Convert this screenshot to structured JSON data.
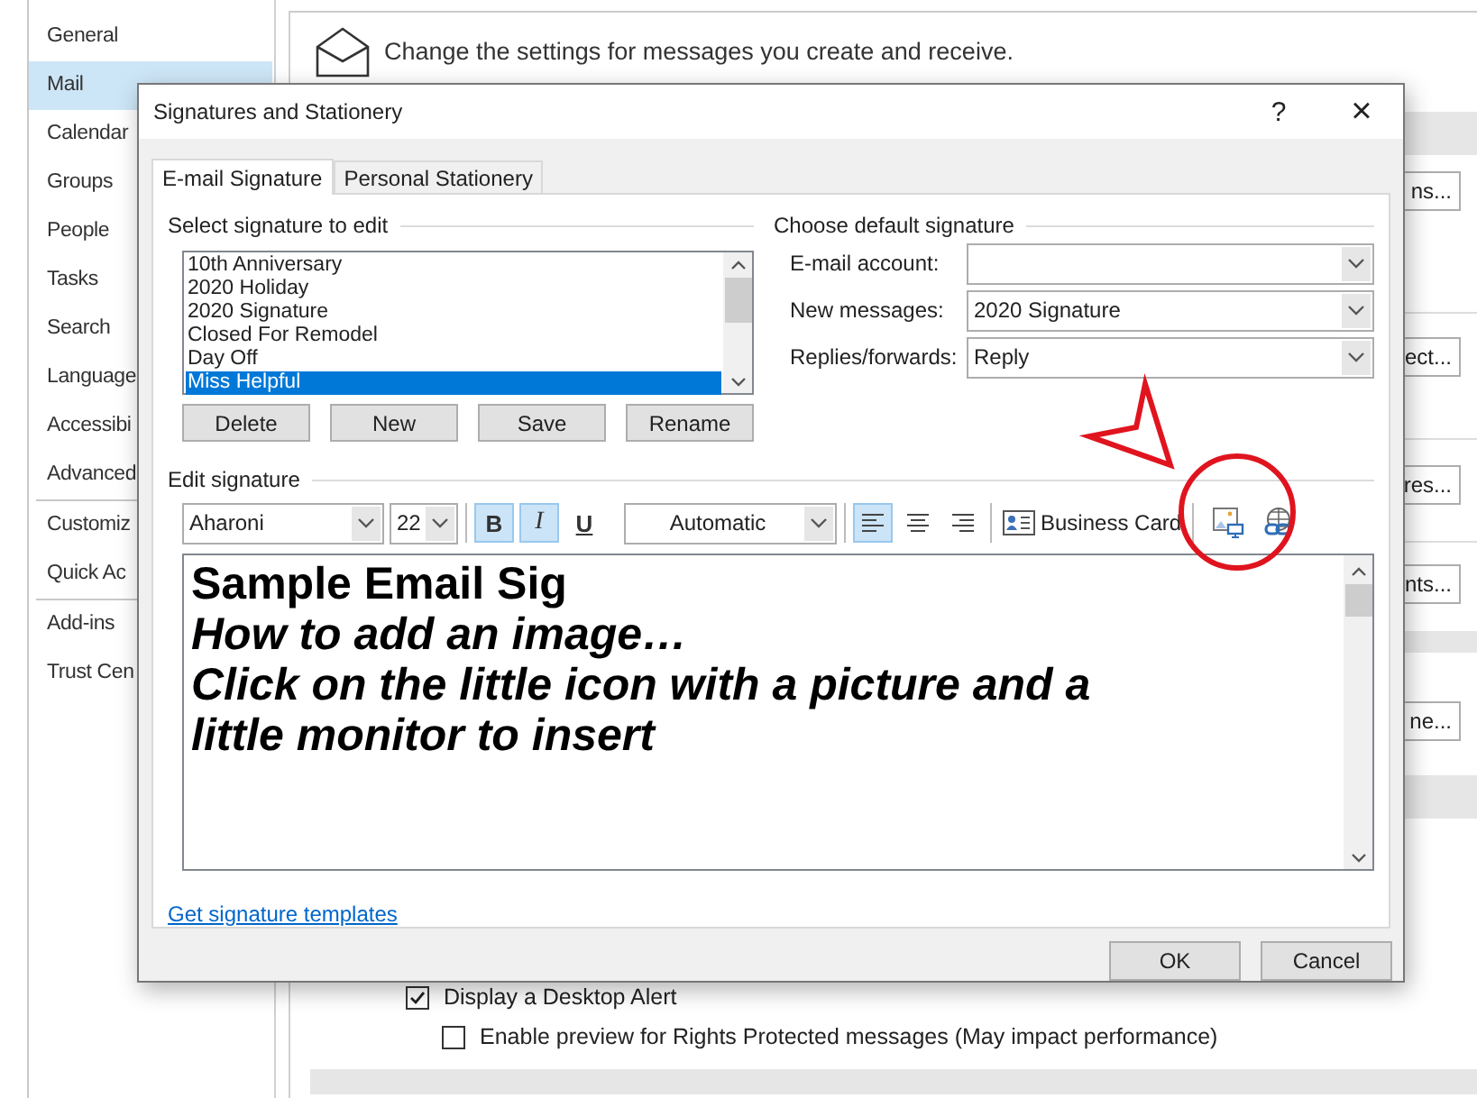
{
  "sidebar": {
    "items": [
      {
        "label": "General",
        "selected": false,
        "divider_after": false
      },
      {
        "label": "Mail",
        "selected": true,
        "divider_after": false
      },
      {
        "label": "Calendar",
        "selected": false,
        "divider_after": false
      },
      {
        "label": "Groups",
        "selected": false,
        "divider_after": false
      },
      {
        "label": "People",
        "selected": false,
        "divider_after": false
      },
      {
        "label": "Tasks",
        "selected": false,
        "divider_after": false
      },
      {
        "label": "Search",
        "selected": false,
        "divider_after": false
      },
      {
        "label": "Language",
        "selected": false,
        "divider_after": false
      },
      {
        "label": "Accessibi",
        "selected": false,
        "divider_after": false
      },
      {
        "label": "Advanced",
        "selected": false,
        "divider_after": true
      },
      {
        "label": "Customiz",
        "selected": false,
        "divider_after": false
      },
      {
        "label": "Quick Ac",
        "selected": false,
        "divider_after": true
      },
      {
        "label": "Add-ins",
        "selected": false,
        "divider_after": false
      },
      {
        "label": "Trust Cen",
        "selected": false,
        "divider_after": false
      }
    ]
  },
  "header": {
    "text": "Change the settings for messages you create and receive."
  },
  "side_buttons": [
    "ns...",
    "ect...",
    "res...",
    "nts...",
    "ne..."
  ],
  "options": [
    {
      "label": "Display a Desktop Alert",
      "checked": true
    },
    {
      "label": "Enable preview for Rights Protected messages (May impact performance)",
      "checked": false
    }
  ],
  "dialog": {
    "title": "Signatures and Stationery",
    "help": "?",
    "close": "×",
    "tabs": [
      {
        "label": "E-mail Signature",
        "selected": true
      },
      {
        "label": "Personal Stationery",
        "selected": false
      }
    ],
    "select_group": {
      "title": "Select signature to edit",
      "signatures": [
        {
          "name": "10th Anniversary",
          "selected": false
        },
        {
          "name": "2020 Holiday",
          "selected": false
        },
        {
          "name": "2020 Signature",
          "selected": false
        },
        {
          "name": "Closed For Remodel",
          "selected": false
        },
        {
          "name": "Day Off",
          "selected": false
        },
        {
          "name": "Miss Helpful",
          "selected": true
        }
      ],
      "buttons": [
        "Delete",
        "New",
        "Save",
        "Rename"
      ]
    },
    "default_group": {
      "title": "Choose default signature",
      "fields": [
        {
          "label": "E-mail account:"
        },
        {
          "label": "New messages:",
          "value": "2020 Signature"
        },
        {
          "label": "Replies/forwards:",
          "value": "Reply"
        }
      ]
    },
    "edit_group": {
      "title": "Edit signature",
      "font": "Aharoni",
      "size": "22",
      "format_buttons": [
        {
          "label": "B",
          "kind": "bold",
          "selected": true
        },
        {
          "label": "I",
          "kind": "italic",
          "selected": true
        },
        {
          "label": "U",
          "kind": "underline",
          "selected": false
        }
      ],
      "font_color": "Automatic",
      "align_buttons": [
        {
          "kind": "left",
          "selected": true
        },
        {
          "kind": "center",
          "selected": false
        },
        {
          "kind": "right",
          "selected": false
        }
      ],
      "business_card": "Business Card",
      "lines": [
        {
          "text": "Sample Email Sig",
          "kind": "bold"
        },
        {
          "text": "How to add an image…",
          "kind": "bold-italic"
        },
        {
          "text": "Click on the little icon with a picture and a",
          "kind": "bold-italic"
        },
        {
          "text": "little monitor to insert",
          "kind": "bold-italic"
        }
      ]
    },
    "link": "Get signature templates",
    "buttons": [
      "OK",
      "Cancel"
    ]
  }
}
